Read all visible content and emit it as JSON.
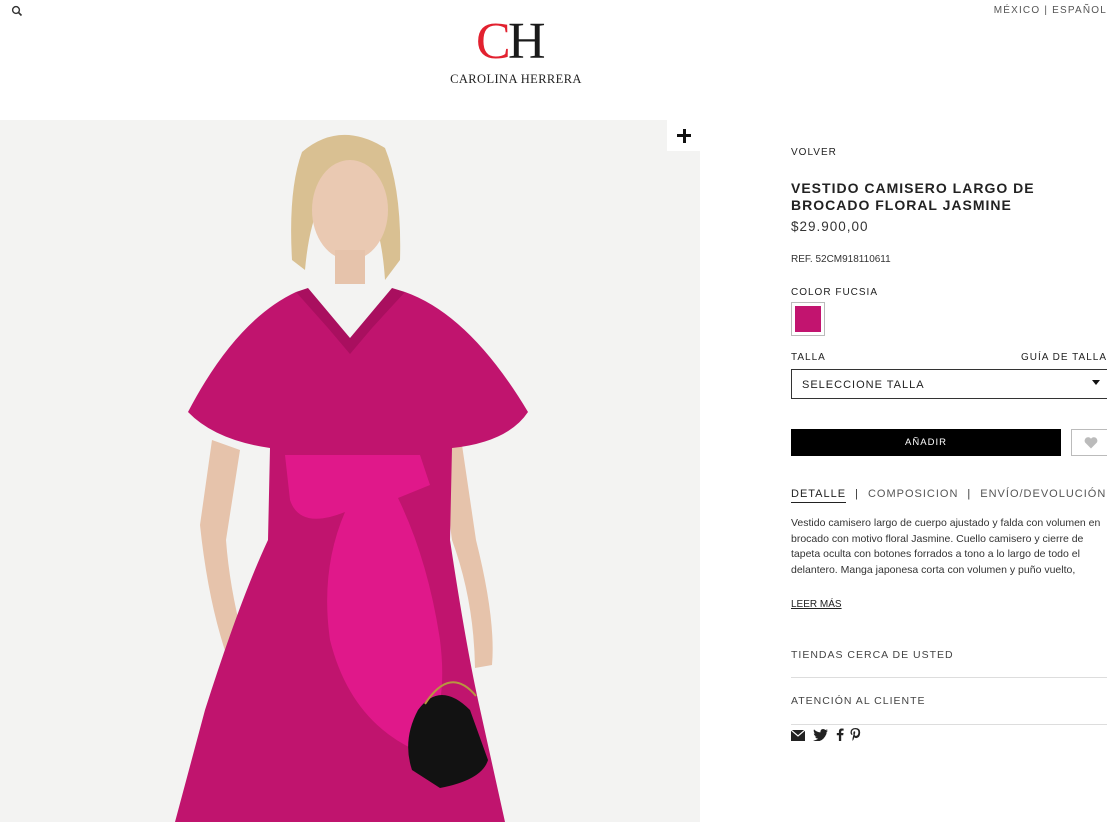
{
  "header": {
    "locale": "MÉXICO | ESPAÑOL",
    "brand_name": "CAROLINA HERRERA",
    "logo_letters": "CH"
  },
  "product": {
    "back_label": "VOLVER",
    "title": "VESTIDO CAMISERO LARGO DE BROCADO FLORAL JASMINE",
    "price": "$29.900,00",
    "reference": "REF. 52CM918110611",
    "color_label": "COLOR FUCSIA",
    "color_hex": "#C2146F",
    "size_label": "TALLA",
    "size_guide_label": "GUÍA DE TALLAS",
    "size_placeholder": "SELECCIONE TALLA",
    "add_label": "AÑADIR",
    "tabs": [
      {
        "label": "DETALLE",
        "active": true
      },
      {
        "label": "COMPOSICION",
        "active": false
      },
      {
        "label": "ENVÍO/DEVOLUCIÓN",
        "active": false
      }
    ],
    "description": "Vestido camisero largo de cuerpo ajustado y falda con volumen en brocado con motivo floral Jasmine. Cuello camisero y cierre de tapeta oculta con botones forrados a tono a lo largo de todo el delantero. Manga japonesa corta con volumen y puño vuelto,",
    "read_more_label": "LEER MÁS",
    "stores_label": "TIENDAS CERCA DE USTED",
    "customer_service_label": "ATENCIÓN AL CLIENTE"
  },
  "share": [
    "email-icon",
    "twitter-icon",
    "facebook-icon",
    "pinterest-icon"
  ],
  "colors": {
    "dress": "#C2146F",
    "accent_red": "#E2212F",
    "text_dark": "#222222",
    "button_black": "#000000"
  }
}
